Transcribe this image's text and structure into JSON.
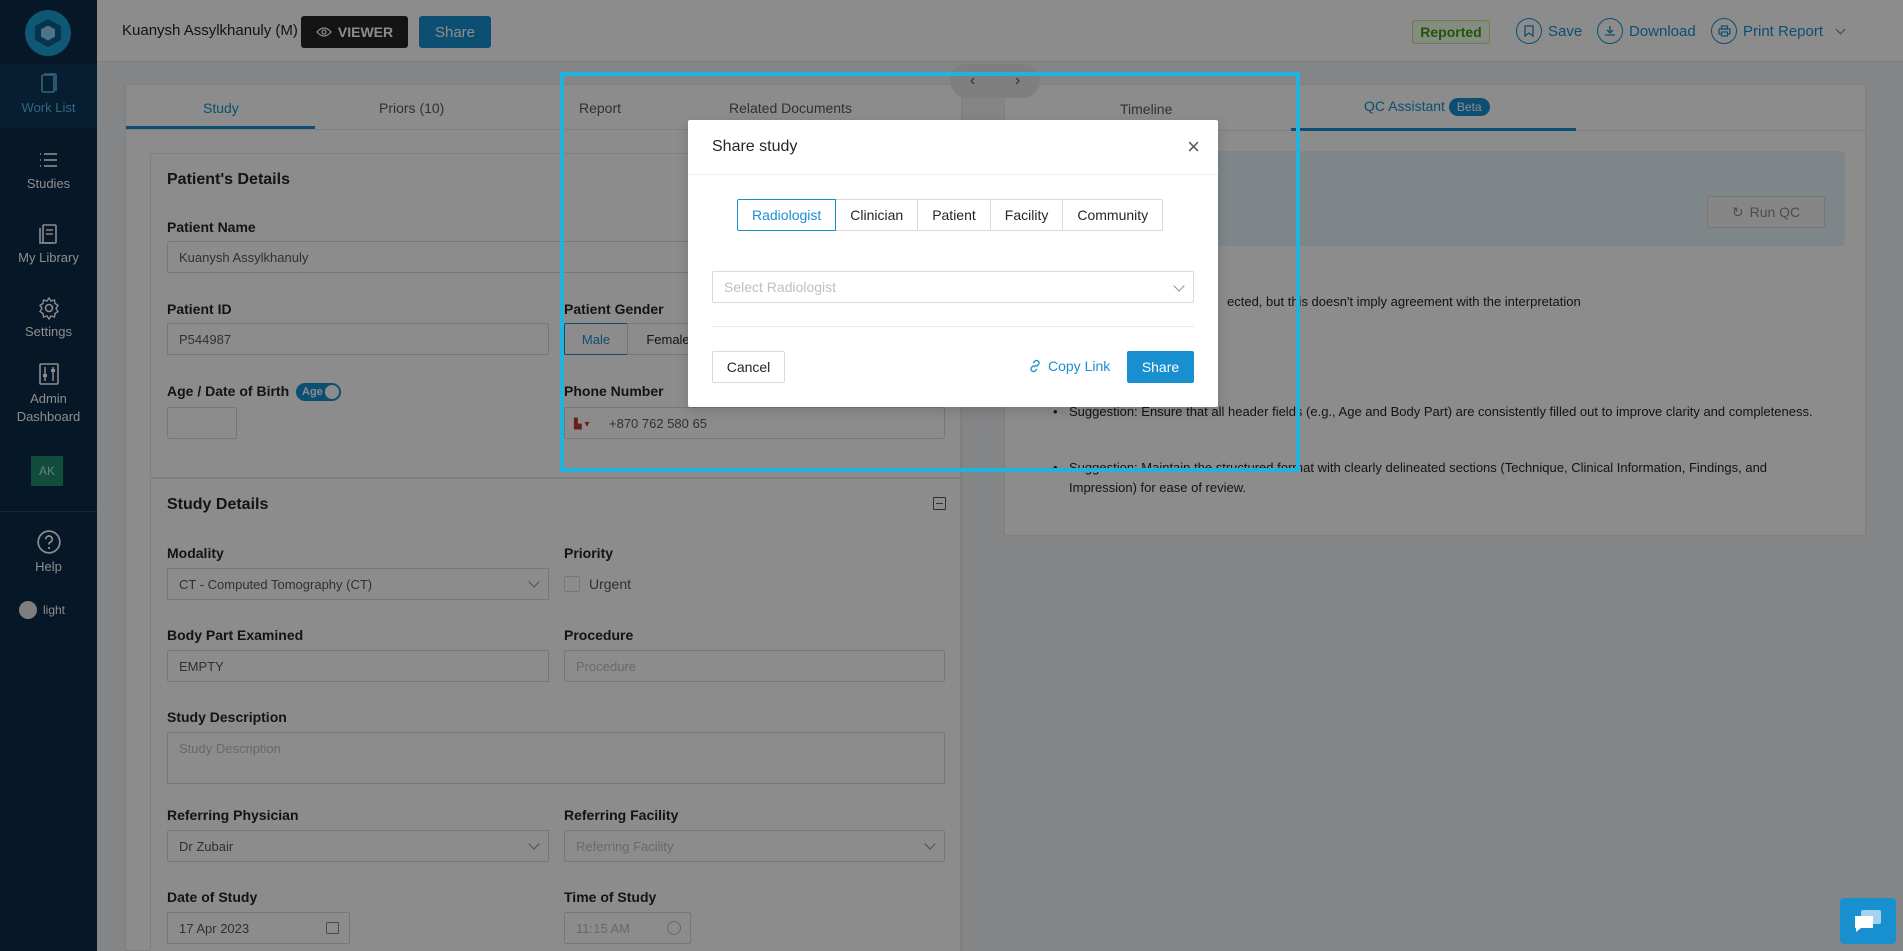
{
  "sidebar": {
    "items": [
      {
        "label": "Work List",
        "icon": "worklist-icon"
      },
      {
        "label": "Studies",
        "icon": "list-icon"
      },
      {
        "label": "My Library",
        "icon": "library-icon"
      },
      {
        "label": "Settings",
        "icon": "gear-icon"
      },
      {
        "label": "Admin Dashboard",
        "icon": "sliders-icon"
      }
    ],
    "avatar": "AK",
    "help": "Help",
    "theme": "light"
  },
  "topbar": {
    "patient_title": "Kuanysh Assylkhanuly (M)",
    "viewer_label": "VIEWER",
    "share_label": "Share",
    "status": "Reported",
    "save_label": "Save",
    "download_label": "Download",
    "print_label": "Print Report"
  },
  "left_tabs": [
    "Study",
    "Priors (10)",
    "Report",
    "Related Documents"
  ],
  "patient": {
    "section_title": "Patient's Details",
    "name_label": "Patient Name",
    "name_value": "Kuanysh Assylkhanuly",
    "id_label": "Patient ID",
    "id_value": "P544987",
    "gender_label": "Patient Gender",
    "gender_options": [
      "Male",
      "Female"
    ],
    "age_label": "Age / Date of Birth",
    "age_toggle": "Age",
    "phone_label": "Phone Number",
    "phone_value": "+870 762 580 65"
  },
  "study": {
    "section_title": "Study Details",
    "modality_label": "Modality",
    "modality_value": "CT - Computed Tomography (CT)",
    "priority_label": "Priority",
    "urgent_label": "Urgent",
    "bodypart_label": "Body Part Examined",
    "bodypart_value": "EMPTY",
    "procedure_label": "Procedure",
    "procedure_placeholder": "Procedure",
    "description_label": "Study Description",
    "description_placeholder": "Study Description",
    "ref_phys_label": "Referring Physician",
    "ref_phys_value": "Dr Zubair",
    "ref_fac_label": "Referring Facility",
    "ref_fac_placeholder": "Referring Facility",
    "date_label": "Date of Study",
    "date_value": "17 Apr 2023",
    "time_label": "Time of Study",
    "time_value": "11:15 AM"
  },
  "right_tabs": {
    "timeline": "Timeline",
    "qc": "QC Assistant",
    "beta": "Beta"
  },
  "qc": {
    "run_label": "Run QC",
    "line1": "ected, but this doesn't imply agreement with the interpretation",
    "bullet1": "Suggestion: Ensure that all header fields (e.g., Age and Body Part) are consistently filled out to improve clarity and completeness.",
    "bullet2": "Suggestion: Maintain the structured format with clearly delineated sections (Technique, Clinical Information, Findings, and Impression) for ease of review."
  },
  "modal": {
    "title": "Share study",
    "tabs": [
      "Radiologist",
      "Clinician",
      "Patient",
      "Facility",
      "Community"
    ],
    "active_tab": "Radiologist",
    "select_placeholder": "Select Radiologist",
    "cancel_label": "Cancel",
    "copy_link_label": "Copy Link",
    "share_label": "Share"
  },
  "colors": {
    "sidebar": "#0b2a4a",
    "accent": "#1890d0",
    "highlight": "#1fb3dd",
    "status_green": "#389e0d"
  }
}
